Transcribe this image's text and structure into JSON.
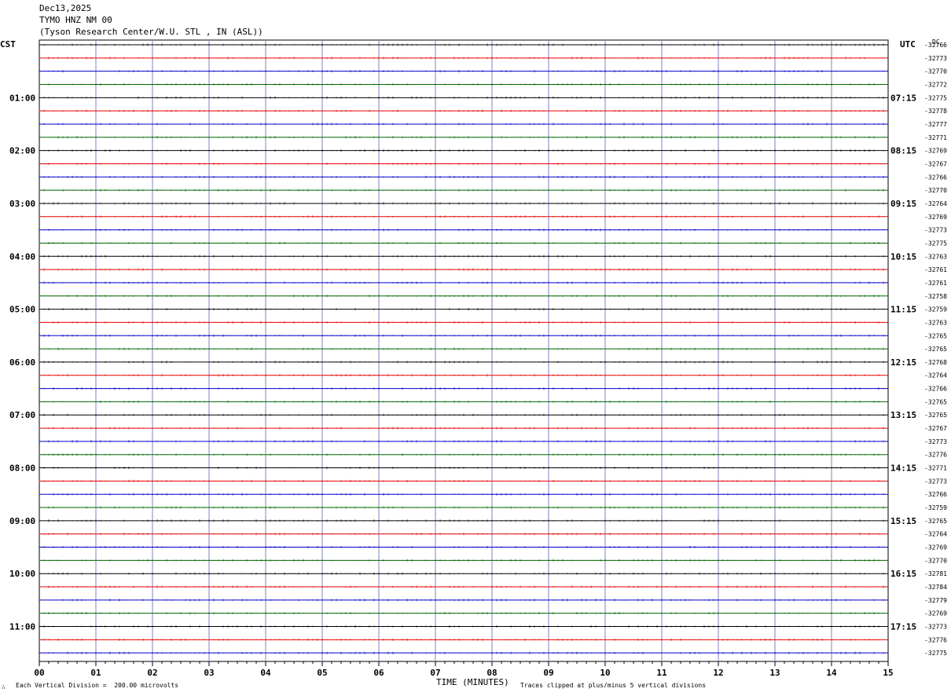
{
  "header": {
    "date": "Dec13,2025",
    "station": "TYMO HNZ NM 00",
    "location": "(Tyson Research Center/W.U. STL , IN (ASL))"
  },
  "left_timezone": "CST",
  "right_timezone": "UTC",
  "dc_header": "DC",
  "footer": {
    "x_axis_title": "TIME (MINUTES)",
    "scale_note": "Each Vertical Division =  200.00 microvolts",
    "clip_note": "Traces clipped at plus/minus 5 vertical divisions",
    "corner_mark": "∴"
  },
  "colors": {
    "trace_cycle": [
      "#000000",
      "#e60000",
      "#0000cc",
      "#006600"
    ],
    "vertical_grid": "#8080c0",
    "frame": "#000000"
  },
  "chart_data": {
    "type": "line",
    "title": "TYMO HNZ NM 00",
    "xlabel": "TIME (MINUTES)",
    "x_ticks": [
      "00",
      "01",
      "02",
      "03",
      "04",
      "05",
      "06",
      "07",
      "08",
      "09",
      "10",
      "11",
      "12",
      "13",
      "14",
      "15"
    ],
    "xlim": [
      0,
      15
    ],
    "minutes_per_trace": 15,
    "left_hour_labels": [
      "01:00",
      "02:00",
      "03:00",
      "04:00",
      "05:00",
      "06:00",
      "07:00",
      "08:00",
      "09:00",
      "10:00",
      "11:00"
    ],
    "right_hour_labels": [
      "07:15",
      "08:15",
      "09:15",
      "10:15",
      "11:15",
      "12:15",
      "13:15",
      "14:15",
      "15:15",
      "16:15",
      "17:15"
    ],
    "dc_offsets": [
      -32766,
      -32773,
      -32770,
      -32772,
      -32775,
      -32778,
      -32777,
      -32771,
      -32769,
      -32767,
      -32766,
      -32770,
      -32764,
      -32769,
      -32773,
      -32775,
      -32763,
      -32761,
      -32761,
      -32758,
      -32759,
      -32763,
      -32765,
      -32765,
      -32768,
      -32764,
      -32766,
      -32765,
      -32765,
      -32767,
      -32773,
      -32776,
      -32771,
      -32773,
      -32766,
      -32759,
      -32765,
      -32764,
      -32769,
      -32770,
      -32781,
      -32784,
      -32779,
      -32769,
      -32773,
      -32776,
      -32775
    ],
    "vertical_division_microvolts": 200.0
  }
}
